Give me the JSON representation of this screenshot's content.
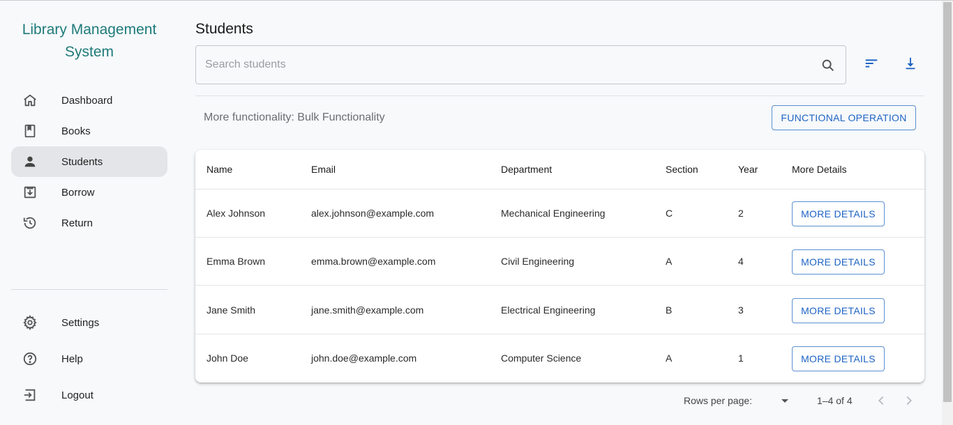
{
  "app": {
    "brand": "Library Management System"
  },
  "sidebar": {
    "items": [
      {
        "label": "Dashboard",
        "icon": "home-icon"
      },
      {
        "label": "Books",
        "icon": "book-icon"
      },
      {
        "label": "Students",
        "icon": "person-icon",
        "active": true
      },
      {
        "label": "Borrow",
        "icon": "borrow-icon"
      },
      {
        "label": "Return",
        "icon": "history-icon"
      }
    ],
    "bottom_items": [
      {
        "label": "Settings",
        "icon": "gear-icon"
      },
      {
        "label": "Help",
        "icon": "help-icon"
      },
      {
        "label": "Logout",
        "icon": "logout-icon"
      }
    ]
  },
  "main": {
    "title": "Students",
    "search": {
      "placeholder": "Search students",
      "value": ""
    },
    "bulk": {
      "text": "More functionality: Bulk Functionality",
      "button": "FUNCTIONAL OPERATION"
    },
    "table": {
      "columns": [
        "Name",
        "Email",
        "Department",
        "Section",
        "Year",
        "More Details"
      ],
      "rows": [
        {
          "name": "Alex Johnson",
          "email": "alex.johnson@example.com",
          "department": "Mechanical Engineering",
          "section": "C",
          "year": "2",
          "action": "MORE DETAILS"
        },
        {
          "name": "Emma Brown",
          "email": "emma.brown@example.com",
          "department": "Civil Engineering",
          "section": "A",
          "year": "4",
          "action": "MORE DETAILS"
        },
        {
          "name": "Jane Smith",
          "email": "jane.smith@example.com",
          "department": "Electrical Engineering",
          "section": "B",
          "year": "3",
          "action": "MORE DETAILS"
        },
        {
          "name": "John Doe",
          "email": "john.doe@example.com",
          "department": "Computer Science",
          "section": "A",
          "year": "1",
          "action": "MORE DETAILS"
        }
      ]
    },
    "pagination": {
      "rows_per_page_label": "Rows per page:",
      "range": "1–4 of 4"
    }
  },
  "colors": {
    "brand": "#1f7a7a",
    "accent": "#1e63c4",
    "active_nav": "#e3e5e8"
  }
}
